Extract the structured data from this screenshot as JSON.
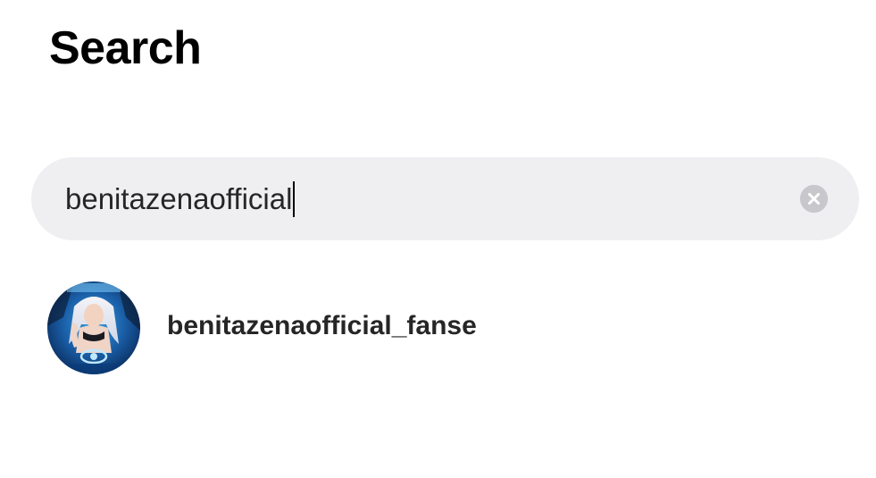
{
  "header": {
    "title": "Search"
  },
  "search": {
    "value": "benitazenaofficial",
    "clear_icon": "clear-circle-icon"
  },
  "results": [
    {
      "username": "benitazenaofficial_fanse",
      "avatar_icon": "profile-picture"
    }
  ],
  "colors": {
    "search_bg": "#efeff2",
    "clear_icon_bg": "#c8c8cc",
    "text": "#262626"
  }
}
